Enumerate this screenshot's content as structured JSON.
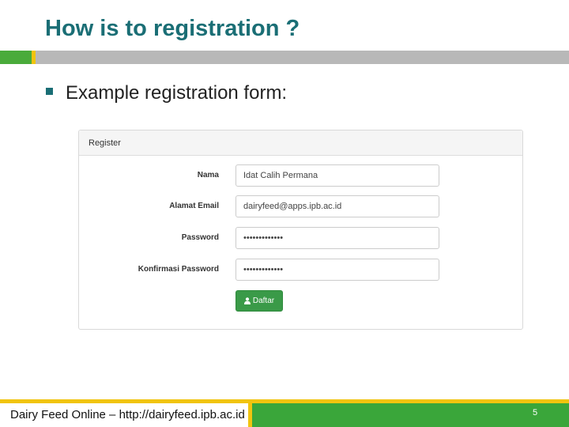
{
  "slide": {
    "title": "How is to registration ?",
    "bullet": "Example registration form:"
  },
  "form": {
    "heading": "Register",
    "fields": [
      {
        "label": "Nama",
        "value": "Idat Calih Permana"
      },
      {
        "label": "Alamat Email",
        "value": "dairyfeed@apps.ipb.ac.id"
      },
      {
        "label": "Password",
        "value": "•••••••••••••"
      },
      {
        "label": "Konfirmasi Password",
        "value": "•••••••••••••"
      }
    ],
    "submit_label": "Daftar",
    "submit_icon": "user-icon"
  },
  "footer": {
    "text": "Dairy Feed Online – http://dairyfeed.ipb.ac.id",
    "page_number": "5"
  },
  "colors": {
    "title": "#1a6e75",
    "accent_green": "#3aa63a",
    "accent_yellow": "#f1c40f",
    "button_green": "#3a9a48"
  }
}
